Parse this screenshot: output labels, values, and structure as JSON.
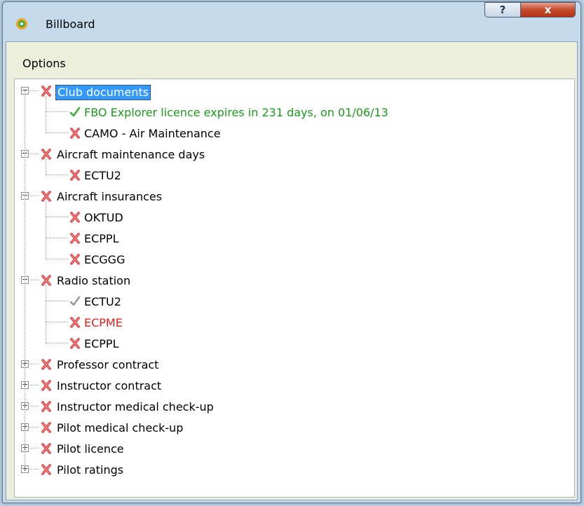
{
  "window": {
    "title": "Billboard",
    "help_label": "?",
    "close_label": "x"
  },
  "menu": {
    "options_label": "Options"
  },
  "tree": {
    "groups": [
      {
        "label": "Club documents",
        "status": "x",
        "expanded": true,
        "selected": true,
        "children": [
          {
            "label": "FBO Explorer licence expires in 231 days, on 01/06/13",
            "status": "check-green",
            "color": "#1a9b1a"
          },
          {
            "label": "CAMO - Air Maintenance",
            "status": "x"
          }
        ]
      },
      {
        "label": "Aircraft maintenance days",
        "status": "x",
        "expanded": true,
        "children": [
          {
            "label": "ECTU2",
            "status": "x"
          }
        ]
      },
      {
        "label": "Aircraft insurances",
        "status": "x",
        "expanded": true,
        "children": [
          {
            "label": "OKTUD",
            "status": "x"
          },
          {
            "label": "ECPPL",
            "status": "x"
          },
          {
            "label": "ECGGG",
            "status": "x"
          }
        ]
      },
      {
        "label": "Radio station",
        "status": "x",
        "expanded": true,
        "children": [
          {
            "label": "ECTU2",
            "status": "check-gray"
          },
          {
            "label": "ECPME",
            "status": "x",
            "color": "#e51c1c"
          },
          {
            "label": "ECPPL",
            "status": "x"
          }
        ]
      },
      {
        "label": "Professor contract",
        "status": "x",
        "expanded": false,
        "children": []
      },
      {
        "label": "Instructor contract",
        "status": "x",
        "expanded": false,
        "children": []
      },
      {
        "label": "Instructor medical check-up",
        "status": "x",
        "expanded": false,
        "children": []
      },
      {
        "label": "Pilot medical check-up",
        "status": "x",
        "expanded": false,
        "children": []
      },
      {
        "label": "Pilot licence",
        "status": "x",
        "expanded": false,
        "children": []
      },
      {
        "label": "Pilot ratings",
        "status": "x",
        "expanded": false,
        "children": []
      }
    ]
  },
  "icons": {
    "x": "red-x-icon",
    "check-green": "green-check-icon",
    "check-gray": "gray-check-icon",
    "expanded": "collapse-minus-icon",
    "collapsed": "expand-plus-icon"
  },
  "colors": {
    "x_red": "#e03a3a",
    "check_green": "#3fae3f",
    "check_gray": "#9a9a9a",
    "selection": "#3399ff"
  }
}
